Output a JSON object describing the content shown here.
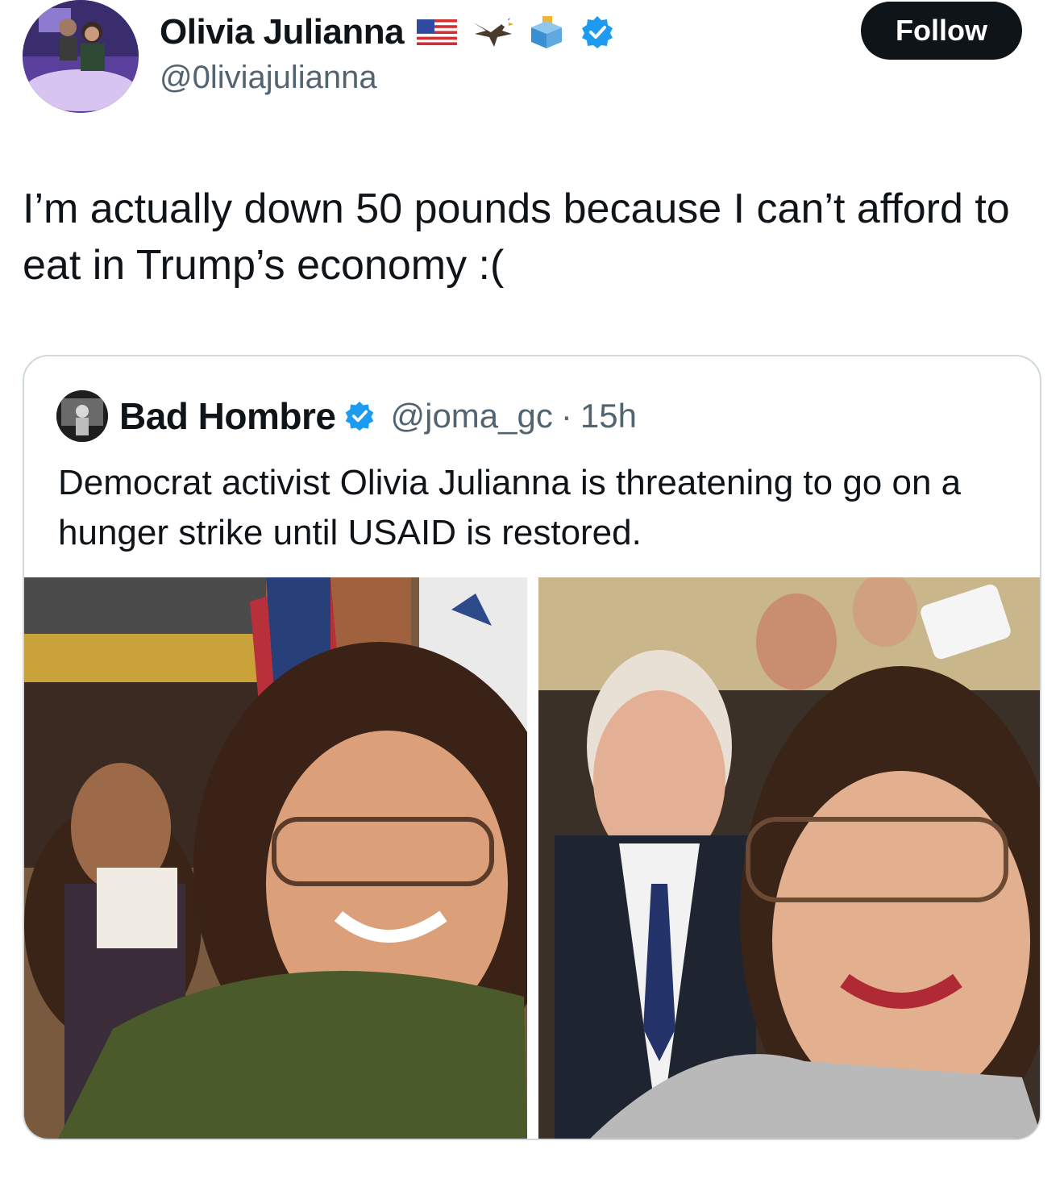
{
  "author": {
    "name": "Olivia Julianna",
    "handle": "@0liviajulianna",
    "emojis": [
      "us-flag-icon",
      "eagle-icon",
      "ballot-box-icon"
    ],
    "verified": true
  },
  "follow_label": "Follow",
  "tweet": {
    "text": "I’m actually down 50 pounds because I can’t afford to eat in Trump’s economy :("
  },
  "quote": {
    "name": "Bad Hombre",
    "handle": "@joma_gc",
    "separator": "·",
    "time": "15h",
    "verified": true,
    "text": "Democrat activist Olivia Julianna is threatening to go on a hunger strike until USAID is restored."
  },
  "colors": {
    "text": "#0f1419",
    "secondary": "#536471",
    "verified_blue": "#1d9bf0",
    "border": "#cfd9de",
    "follow_bg": "#0f1419"
  }
}
